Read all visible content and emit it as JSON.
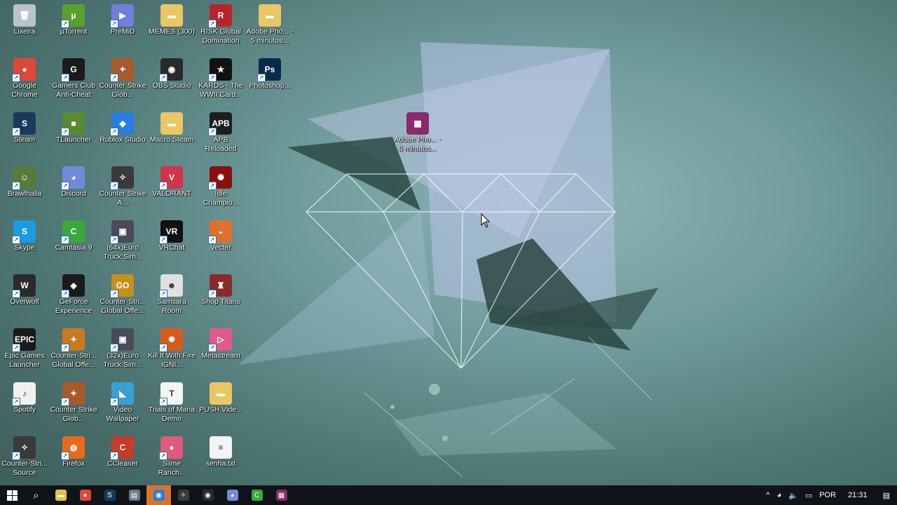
{
  "desktop_icons": [
    {
      "label": "Lixeira",
      "col": 0,
      "row": 0,
      "color": "#b9c3cc",
      "glyph": "🗑",
      "shortcut": false
    },
    {
      "label": "µTorrent",
      "col": 1,
      "row": 0,
      "color": "#5aa02c",
      "glyph": "µ",
      "shortcut": true
    },
    {
      "label": "PreMiD",
      "col": 2,
      "row": 0,
      "color": "#6e7fdc",
      "glyph": "▶",
      "shortcut": true
    },
    {
      "label": "MEMES (300)",
      "col": 3,
      "row": 0,
      "color": "#e8c764",
      "glyph": "▬",
      "shortcut": false
    },
    {
      "label": "RISK Global Domination",
      "col": 4,
      "row": 0,
      "color": "#b8242c",
      "glyph": "R",
      "shortcut": true
    },
    {
      "label": "Adobe Pho... - 5 minutos...",
      "col": 5,
      "row": 0,
      "color": "#e8c764",
      "glyph": "▬",
      "shortcut": false
    },
    {
      "label": "Google Chrome",
      "col": 0,
      "row": 1,
      "color": "#e0463a",
      "glyph": "●",
      "shortcut": true
    },
    {
      "label": "Gamers Club Anti-Cheat",
      "col": 1,
      "row": 1,
      "color": "#1b1b1b",
      "glyph": "G",
      "shortcut": true
    },
    {
      "label": "Counter Strike Glob...",
      "col": 2,
      "row": 1,
      "color": "#a85a2a",
      "glyph": "✦",
      "shortcut": true
    },
    {
      "label": "OBS Studio",
      "col": 3,
      "row": 1,
      "color": "#2a2a2a",
      "glyph": "◉",
      "shortcut": true
    },
    {
      "label": "KARDS - The WWII Card...",
      "col": 4,
      "row": 1,
      "color": "#111111",
      "glyph": "★",
      "shortcut": true
    },
    {
      "label": "Photoshop...",
      "col": 5,
      "row": 1,
      "color": "#0b2a4a",
      "glyph": "Ps",
      "shortcut": true
    },
    {
      "label": "Steam",
      "col": 0,
      "row": 2,
      "color": "#1a3a5c",
      "glyph": "S",
      "shortcut": true
    },
    {
      "label": "TLauncher",
      "col": 1,
      "row": 2,
      "color": "#5a8a2e",
      "glyph": "■",
      "shortcut": true
    },
    {
      "label": "Roblox Studio",
      "col": 2,
      "row": 2,
      "color": "#2a7de0",
      "glyph": "◆",
      "shortcut": true
    },
    {
      "label": "Macro Steam",
      "col": 3,
      "row": 2,
      "color": "#e8c764",
      "glyph": "▬",
      "shortcut": false
    },
    {
      "label": "APB Reloaded",
      "col": 4,
      "row": 2,
      "color": "#1e1e1e",
      "glyph": "APB",
      "shortcut": true
    },
    {
      "label": "Brawlhalla",
      "col": 0,
      "row": 3,
      "color": "#5a7a3a",
      "glyph": "☺",
      "shortcut": true
    },
    {
      "label": "Discord",
      "col": 1,
      "row": 3,
      "color": "#7289da",
      "glyph": "◕",
      "shortcut": true
    },
    {
      "label": "Counter Strike A...",
      "col": 2,
      "row": 3,
      "color": "#3a3a3a",
      "glyph": "✧",
      "shortcut": true
    },
    {
      "label": "VALORANT",
      "col": 3,
      "row": 3,
      "color": "#d2344a",
      "glyph": "V",
      "shortcut": true
    },
    {
      "label": "Idle Champio...",
      "col": 4,
      "row": 3,
      "color": "#8a1010",
      "glyph": "✺",
      "shortcut": true
    },
    {
      "label": "Skype",
      "col": 0,
      "row": 4,
      "color": "#1b9be0",
      "glyph": "S",
      "shortcut": true
    },
    {
      "label": "Camtasia 9",
      "col": 1,
      "row": 4,
      "color": "#3ba83b",
      "glyph": "C",
      "shortcut": true
    },
    {
      "label": "(64x)Euro Truck Sim...",
      "col": 2,
      "row": 4,
      "color": "#4a4a5a",
      "glyph": "▣",
      "shortcut": true
    },
    {
      "label": "VRChat",
      "col": 3,
      "row": 4,
      "color": "#111111",
      "glyph": "VR",
      "shortcut": true
    },
    {
      "label": "Vecter",
      "col": 4,
      "row": 4,
      "color": "#e07030",
      "glyph": "◒",
      "shortcut": true
    },
    {
      "label": "Overwolf",
      "col": 0,
      "row": 5,
      "color": "#2a2a2a",
      "glyph": "W",
      "shortcut": true
    },
    {
      "label": "GeForce Experience",
      "col": 1,
      "row": 5,
      "color": "#1a1a1a",
      "glyph": "◈",
      "shortcut": true
    },
    {
      "label": "Counter-Stri... Global Offe...",
      "col": 2,
      "row": 5,
      "color": "#c8901a",
      "glyph": "GO",
      "shortcut": true
    },
    {
      "label": "Samsara Room",
      "col": 3,
      "row": 5,
      "color": "#e0e0e0",
      "glyph": "☻",
      "shortcut": true
    },
    {
      "label": "Shop Titans",
      "col": 4,
      "row": 5,
      "color": "#8a2a2a",
      "glyph": "♜",
      "shortcut": true
    },
    {
      "label": "Epic Games Launcher",
      "col": 0,
      "row": 6,
      "color": "#1a1a1a",
      "glyph": "EPIC",
      "shortcut": true
    },
    {
      "label": "Counter-Stri... Global Offe...",
      "col": 1,
      "row": 6,
      "color": "#c87a20",
      "glyph": "✦",
      "shortcut": true
    },
    {
      "label": "(32x)Euro Truck Sim...",
      "col": 2,
      "row": 6,
      "color": "#4a4a5a",
      "glyph": "▣",
      "shortcut": true
    },
    {
      "label": "Kill It With Fire IGNI...",
      "col": 3,
      "row": 6,
      "color": "#d85a1a",
      "glyph": "✹",
      "shortcut": true
    },
    {
      "label": "Metastream",
      "col": 4,
      "row": 6,
      "color": "#e05a8a",
      "glyph": "▷",
      "shortcut": true
    },
    {
      "label": "Spotify",
      "col": 0,
      "row": 7,
      "color": "#f0f0f0",
      "glyph": "♪",
      "shortcut": true
    },
    {
      "label": "Counter Strike Glob...",
      "col": 1,
      "row": 7,
      "color": "#a85a2a",
      "glyph": "✦",
      "shortcut": true
    },
    {
      "label": "Video Wallpaper",
      "col": 2,
      "row": 7,
      "color": "#3aa0d0",
      "glyph": "◣",
      "shortcut": true
    },
    {
      "label": "Trials of Mana Demo",
      "col": 3,
      "row": 7,
      "color": "#f4f4f4",
      "glyph": "T",
      "shortcut": true
    },
    {
      "label": "PUSH.Vide...",
      "col": 4,
      "row": 7,
      "color": "#e8c764",
      "glyph": "▬",
      "shortcut": false
    },
    {
      "label": "Counter-Stri... Source",
      "col": 0,
      "row": 8,
      "color": "#3a3a3a",
      "glyph": "✧",
      "shortcut": true
    },
    {
      "label": "Firefox",
      "col": 1,
      "row": 8,
      "color": "#e86a1a",
      "glyph": "◍",
      "shortcut": true
    },
    {
      "label": "CCleaner",
      "col": 2,
      "row": 8,
      "color": "#c83a2a",
      "glyph": "C",
      "shortcut": true
    },
    {
      "label": "Slime Ranch...",
      "col": 3,
      "row": 8,
      "color": "#e05a7a",
      "glyph": "●",
      "shortcut": true
    },
    {
      "label": "senha.txt",
      "col": 4,
      "row": 8,
      "color": "#f4f4f4",
      "glyph": "≡",
      "shortcut": false
    }
  ],
  "floating_icon": {
    "label": "Adobe Pho... - 5 minutos...",
    "color": "#8a2a6a",
    "glyph": "▦"
  },
  "taskbar": {
    "start_icon": "windows-logo",
    "pinned": [
      {
        "name": "search",
        "glyph": "⌕",
        "color": "transparent",
        "active": false
      },
      {
        "name": "file-explorer",
        "glyph": "▬",
        "color": "#e8c040",
        "active": false
      },
      {
        "name": "chrome",
        "glyph": "●",
        "color": "#e0463a",
        "active": false
      },
      {
        "name": "steam",
        "glyph": "S",
        "color": "#1a3a5c",
        "active": false
      },
      {
        "name": "app",
        "glyph": "▤",
        "color": "#6a7a8a",
        "active": false
      },
      {
        "name": "browser",
        "glyph": "◉",
        "color": "#2a7de0",
        "active": true
      },
      {
        "name": "counter-strike",
        "glyph": "✧",
        "color": "#3a3a3a",
        "active": false
      },
      {
        "name": "obs",
        "glyph": "◉",
        "color": "#2a2a2a",
        "active": false
      },
      {
        "name": "discord",
        "glyph": "◕",
        "color": "#7289da",
        "active": false
      },
      {
        "name": "camtasia",
        "glyph": "C",
        "color": "#3ba83b",
        "active": false
      },
      {
        "name": "winrar",
        "glyph": "▦",
        "color": "#8a2a6a",
        "active": false
      }
    ],
    "tray": {
      "chevron": "^",
      "language": "POR",
      "time": "21:31"
    }
  }
}
